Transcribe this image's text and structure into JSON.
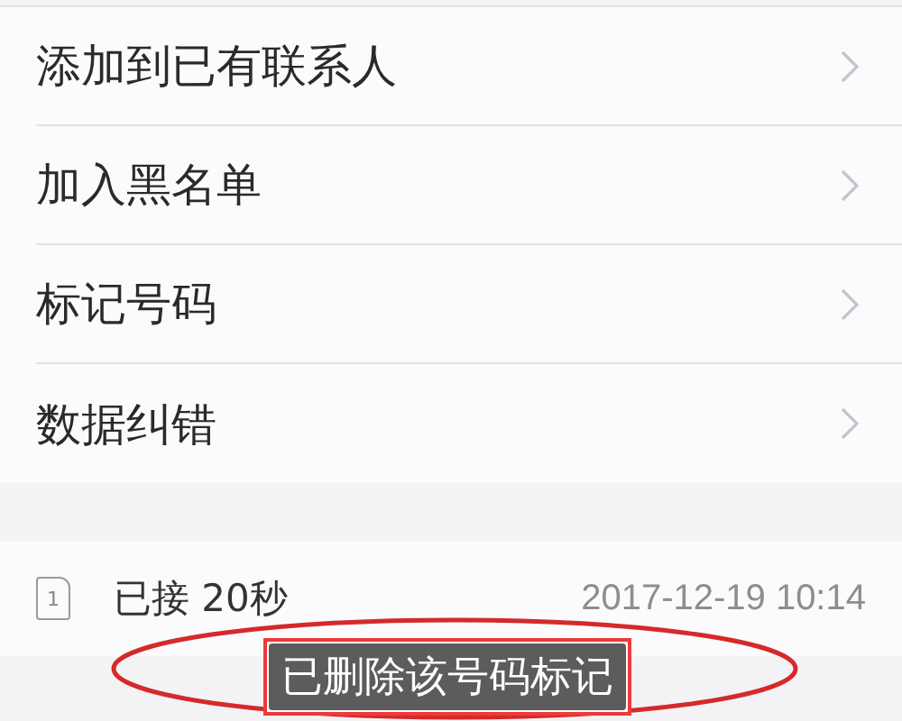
{
  "menu_items": [
    {
      "label": "添加到已有联系人"
    },
    {
      "label": "加入黑名单"
    },
    {
      "label": "标记号码"
    },
    {
      "label": "数据纠错"
    }
  ],
  "call_log": {
    "sim_slot": "1",
    "status": "已接 20秒",
    "time": "2017-12-19 10:14"
  },
  "toast": {
    "text": "已删除该号码标记"
  }
}
